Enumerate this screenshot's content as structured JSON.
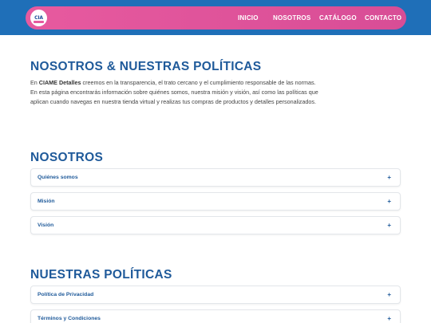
{
  "nav": {
    "logo_text": "CIA",
    "items": [
      "INICIO",
      "NOSOTROS",
      "CATÁLOGO",
      "CONTACTO"
    ]
  },
  "main": {
    "title": "NOSOTROS & NUESTRAS POLÍTICAS",
    "intro_prefix": "En ",
    "intro_brand": "CIAME Detalles",
    "intro_rest": " creemos en la transparencia, el trato cercano y el cumplimiento responsable de las normas. En esta página encontrarás información sobre quiénes somos, nuestra misión y visión, así como las políticas que aplican cuando navegas en nuestra tienda virtual y realizas tus compras de productos y detalles personalizados."
  },
  "nosotros": {
    "heading": "NOSOTROS",
    "items": [
      "Quiénes somos",
      "Misión",
      "Visión"
    ]
  },
  "politicas": {
    "heading": "NUESTRAS POLÍTICAS",
    "items": [
      "Política de Privacidad",
      "Términos y Condiciones"
    ]
  },
  "accordion_toggle": "+",
  "colors": {
    "header_band": "#1f6fb8",
    "nav_pink": "#e75a9f",
    "heading_blue": "#1f5a9a"
  }
}
